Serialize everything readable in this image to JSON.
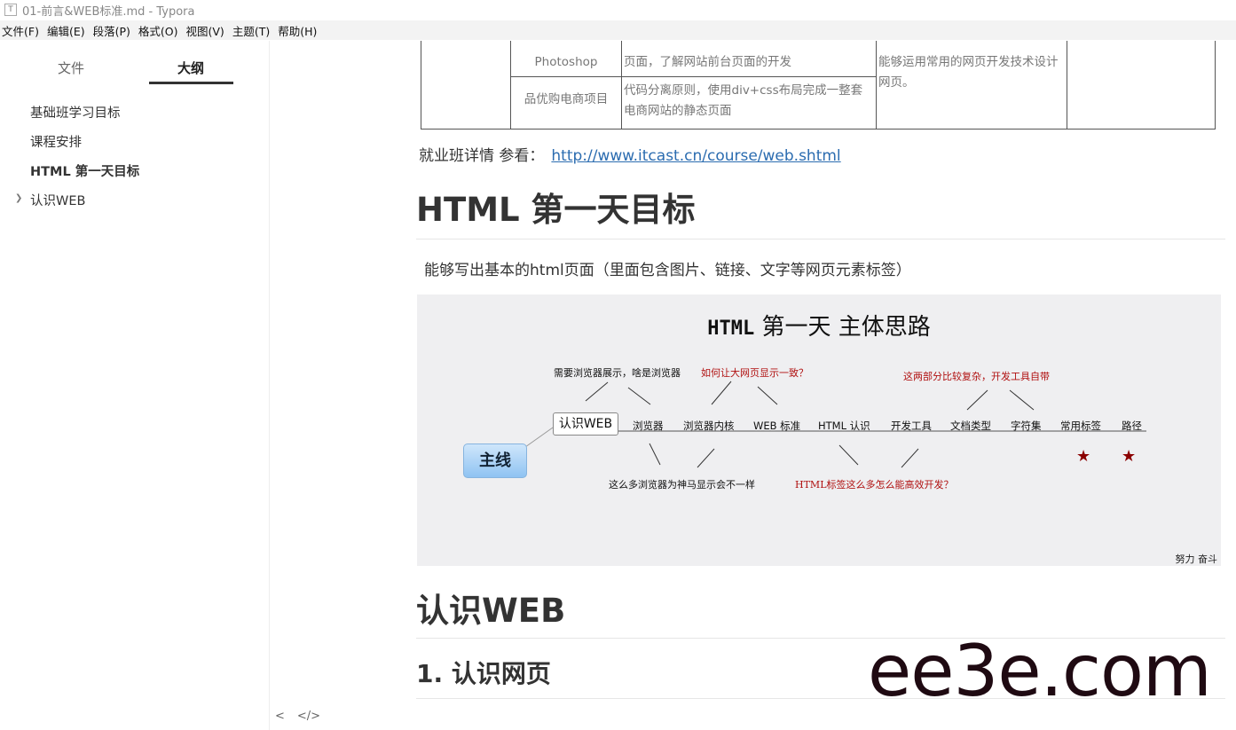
{
  "window": {
    "title": "01-前言&WEB标准.md - Typora",
    "icon": "typora-app-icon"
  },
  "menu": [
    "文件(F)",
    "编辑(E)",
    "段落(P)",
    "格式(O)",
    "视图(V)",
    "主题(T)",
    "帮助(H)"
  ],
  "sidebar": {
    "tabs": [
      {
        "label": "文件"
      },
      {
        "label": "大纲",
        "active": true
      }
    ],
    "outline": [
      {
        "label": "基础班学习目标"
      },
      {
        "label": "课程安排"
      },
      {
        "label": "HTML 第一天目标",
        "active": true
      },
      {
        "label": "认识WEB",
        "collapsed": true
      }
    ],
    "footer": {
      "collapse": "<",
      "source_mode": "</>"
    }
  },
  "content": {
    "table_rows": [
      {
        "col1": "",
        "col2": "Photoshop",
        "col3": "页面，了解网站前台页面的开发",
        "col4": "能够运用常用的网页开发技术设计网页。",
        "col5": ""
      },
      {
        "col2": "品优购电商项目",
        "col3": "代码分离原则，使用div+css布局完成一整套电商网站的静态页面"
      }
    ],
    "link_line": {
      "label": "就业班详情 参看：",
      "url": "http://www.itcast.cn/course/web.shtml"
    },
    "h1_day1": "HTML 第一天目标",
    "paragraph": "能够写出基本的html页面（里面包含图片、链接、文字等网页元素标签）",
    "mindmap": {
      "title_prefix": "HTML",
      "title_rest": "第一天 主体思路",
      "root": "主线",
      "first_node": "认识WEB",
      "chain": [
        "浏览器",
        "浏览器内核",
        "WEB 标准",
        "HTML 认识",
        "开发工具",
        "文档类型",
        "字符集",
        "常用标签",
        "路径"
      ],
      "note_browser": "需要浏览器展示，啥是浏览器",
      "note_consistent": "如何让大网页显示一致？",
      "note_complex": "这两部分比较复杂，开发工具自带",
      "note_why_diff": "这么多浏览器为神马显示会不一样",
      "note_efficient": "HTML标签这么多怎么能高效开发？",
      "signature": "努力 奋斗",
      "star_color": "#8b0000"
    },
    "h1_web": "认识WEB",
    "h2_webpage": "1. 认识网页",
    "watermark": "ee3e.com"
  }
}
